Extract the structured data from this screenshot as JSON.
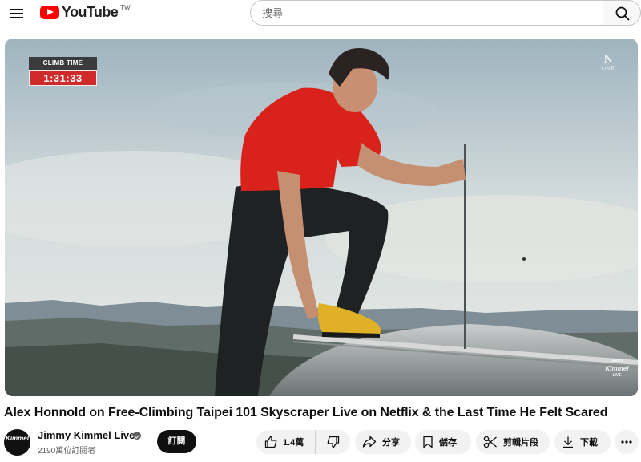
{
  "header": {
    "logo_text": "YouTube",
    "region": "TW",
    "search_placeholder": "搜尋"
  },
  "video": {
    "climb_label": "CLIMB TIME",
    "climb_time": "1:31:33",
    "netflix_label": "N",
    "netflix_live": "LIVE",
    "watermark_top": "JIMMY",
    "watermark_main": "Kimmel",
    "watermark_bottom": "LIVE"
  },
  "title": "Alex Honnold on Free-Climbing Taipei 101 Skyscraper Live on Netflix & the Last Time He Felt Scared",
  "channel": {
    "name": "Jimmy Kimmel Live",
    "subscribers": "2190萬位訂閱者",
    "avatar_text": "Kimmel",
    "subscribe_label": "訂閱"
  },
  "actions": {
    "likes": "1.4萬",
    "share": "分享",
    "save": "儲存",
    "clip": "剪輯片段",
    "download": "下載"
  },
  "colors": {
    "brand_red": "#ff0000",
    "climb_time_bg": "#d12a2a",
    "pill_bg": "#f2f2f2",
    "subscribe_bg": "#0f0f0f"
  },
  "icons": [
    "menu-icon",
    "youtube-logo-icon",
    "search-icon",
    "verified-icon",
    "thumbs-up-icon",
    "thumbs-down-icon",
    "share-icon",
    "bookmark-icon",
    "scissors-icon",
    "download-icon",
    "more-icon"
  ]
}
